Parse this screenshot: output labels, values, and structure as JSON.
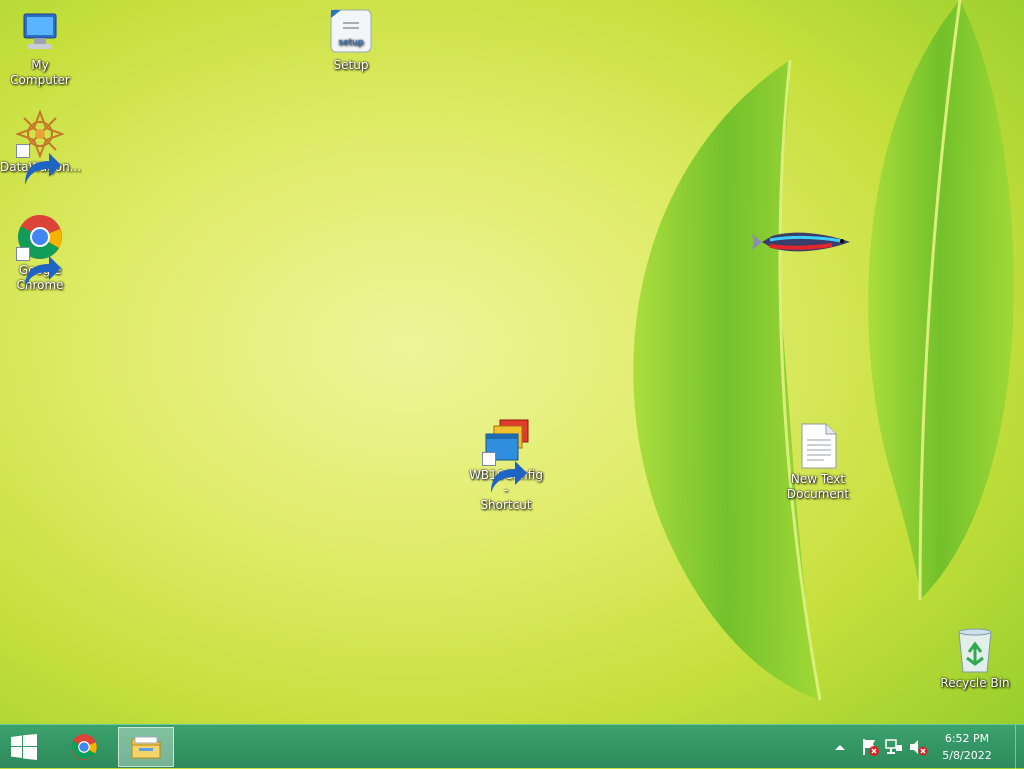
{
  "desktop": {
    "icons": {
      "my_computer": "My Computer",
      "setup": "Setup",
      "setup_badge": "setup",
      "datawagon": "DataWagon...",
      "chrome_line1": "Google",
      "chrome_line2": "Chrome",
      "wb10_line1": "WB10Config -",
      "wb10_line2": "Shortcut",
      "textdoc_line1": "New Text",
      "textdoc_line2": "Document",
      "recycle_bin": "Recycle Bin"
    }
  },
  "taskbar": {
    "clock_time": "6:52 PM",
    "clock_date": "5/8/2022"
  },
  "colors": {
    "taskbar": "#2e8a5c",
    "wallpaper_light": "#eef59a",
    "leaf": "#7cc233"
  }
}
